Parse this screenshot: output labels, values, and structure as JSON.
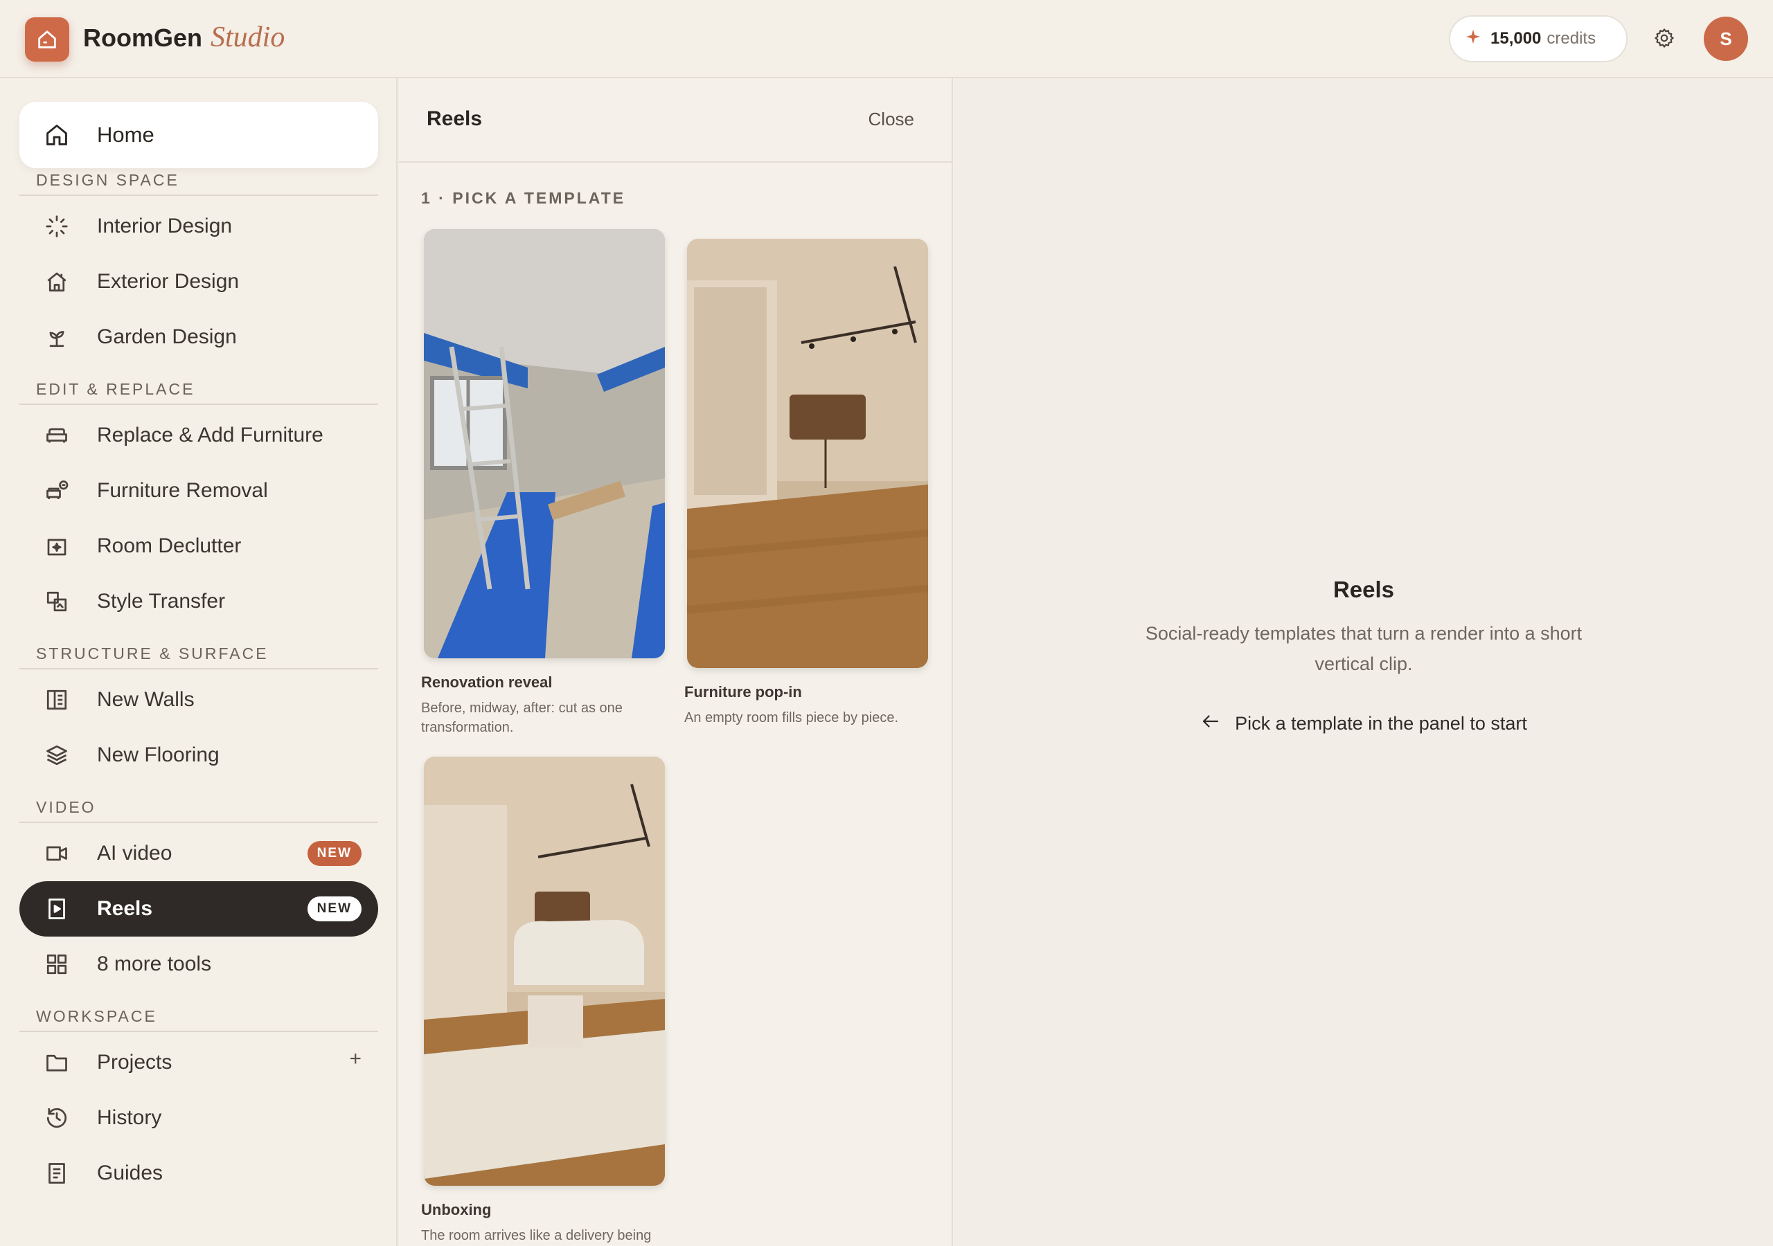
{
  "app": {
    "brand_name": "RoomGen",
    "brand_suffix": "Studio"
  },
  "header": {
    "credits_amount": "15,000",
    "credits_unit": "credits",
    "avatar_initial": "S"
  },
  "sidebar": {
    "home": "Home",
    "sections": {
      "design_space": "DESIGN SPACE",
      "edit_replace": "EDIT & REPLACE",
      "structure_surface": "STRUCTURE & SURFACE",
      "video": "VIDEO",
      "workspace": "WORKSPACE"
    },
    "items": {
      "interior": "Interior Design",
      "exterior": "Exterior Design",
      "garden": "Garden Design",
      "replace_furniture": "Replace & Add Furniture",
      "furniture_removal": "Furniture Removal",
      "declutter": "Room Declutter",
      "style_transfer": "Style Transfer",
      "new_walls": "New Walls",
      "new_flooring": "New Flooring",
      "ai_video": "AI video",
      "reels": "Reels",
      "more_tools": "8 more tools",
      "projects": "Projects",
      "history": "History",
      "guides": "Guides"
    },
    "badges": {
      "ai_video": "NEW",
      "reels": "NEW"
    },
    "projects_add": "+"
  },
  "panel": {
    "title": "Reels",
    "close": "Close",
    "step": "1 · PICK A TEMPLATE",
    "templates": [
      {
        "name": "Renovation reveal",
        "desc": "Before, midway, after: cut as one transformation."
      },
      {
        "name": "Furniture pop-in",
        "desc": "An empty room fills piece by piece."
      },
      {
        "name": "Unboxing",
        "desc": "The room arrives like a delivery being"
      }
    ]
  },
  "main": {
    "title": "Reels",
    "description": "Social-ready templates that turn a render into a short vertical clip.",
    "hint": "Pick a template in the panel to start"
  },
  "colors": {
    "accent": "#cf6a48",
    "active_nav": "#2f2a27",
    "badge": "#c4623f",
    "background": "#f3efe8"
  },
  "icons": {
    "logo": "house-icon",
    "credits": "sparkle-icon",
    "settings": "gear-icon"
  }
}
